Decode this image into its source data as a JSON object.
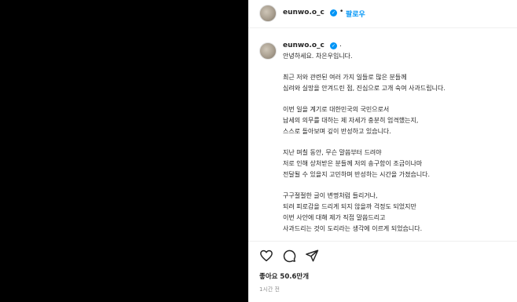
{
  "header": {
    "username": "eunwo.o_c",
    "separator": "•",
    "follow_label": "팔로우",
    "avatar_icon": "profile-avatar"
  },
  "caption": {
    "username": "eunwo.o_c",
    "separator": ".",
    "paragraphs": [
      [
        "안녕하세요. 차은우입니다."
      ],
      [
        "최근 저와 관련된 여러 가지 일들로 많은 분들께",
        "심려와 실망을 안겨드린 점, 진심으로 고개 숙여 사과드립니다."
      ],
      [
        "이번 일을 계기로 대한민국의 국민으로서",
        "납세의 의무를 대하는 제 자세가 충분히 엄격했는지,",
        "스스로 돌아보며 깊이 반성하고 있습니다."
      ],
      [
        "지난 며칠 동안, 무슨 말씀부터 드려야",
        "저로 인해 상처받은 분들께 저의 송구함이 조금이나마",
        "전달될 수 있을지 고민하며 반성하는 시간을 가졌습니다."
      ],
      [
        "구구절절한 글이 변명처럼 들리거나,",
        "되려 피로감을 드리게 되지 않을까 걱정도 되었지만",
        "이번 사안에 대해 제가 직접 말씀드리고",
        "사과드리는 것이 도리라는 생각에 이르게 되었습니다."
      ]
    ]
  },
  "actions": {
    "like_icon": "heart-icon",
    "comment_icon": "comment-icon",
    "share_icon": "share-icon"
  },
  "likes": "좋아요 50.6만개",
  "timestamp": "1시간 전",
  "colors": {
    "accent": "#0095f6",
    "text": "#262626",
    "muted": "#8e8e8e",
    "media_bg": "#000000"
  }
}
